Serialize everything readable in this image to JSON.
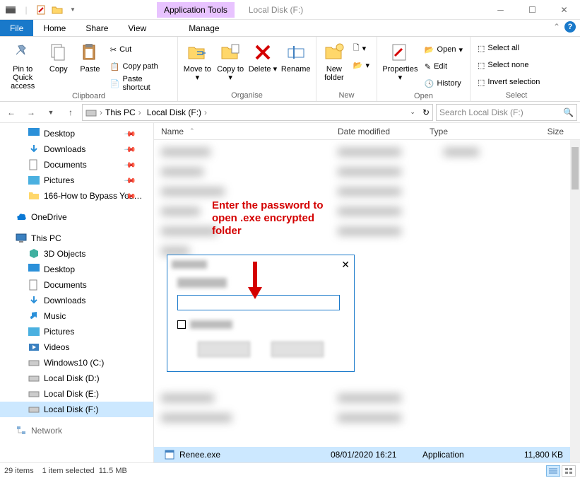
{
  "window": {
    "tools_tab": "Application Tools",
    "title": "Local Disk (F:)"
  },
  "menu": {
    "file": "File",
    "home": "Home",
    "share": "Share",
    "view": "View",
    "manage": "Manage"
  },
  "ribbon": {
    "clipboard": {
      "pin": "Pin to Quick access",
      "copy": "Copy",
      "paste": "Paste",
      "cut": "Cut",
      "copy_path": "Copy path",
      "paste_shortcut": "Paste shortcut",
      "group": "Clipboard"
    },
    "organise": {
      "move_to": "Move to",
      "copy_to": "Copy to",
      "delete": "Delete",
      "rename": "Rename",
      "group": "Organise"
    },
    "new": {
      "new_folder": "New folder",
      "group": "New"
    },
    "open": {
      "properties": "Properties",
      "open": "Open",
      "edit": "Edit",
      "history": "History",
      "group": "Open"
    },
    "select": {
      "select_all": "Select all",
      "select_none": "Select none",
      "invert": "Invert selection",
      "group": "Select"
    }
  },
  "address": {
    "this_pc": "This PC",
    "location": "Local Disk (F:)"
  },
  "search": {
    "placeholder": "Search Local Disk (F:)"
  },
  "columns": {
    "name": "Name",
    "date": "Date modified",
    "type": "Type",
    "size": "Size"
  },
  "nav": {
    "desktop": "Desktop",
    "downloads": "Downloads",
    "documents": "Documents",
    "pictures": "Pictures",
    "bypass": "166-How to Bypass You…",
    "onedrive": "OneDrive",
    "this_pc": "This PC",
    "objects3d": "3D Objects",
    "desktop2": "Desktop",
    "documents2": "Documents",
    "downloads2": "Downloads",
    "music": "Music",
    "pictures2": "Pictures",
    "videos": "Videos",
    "win10": "Windows10 (C:)",
    "diskd": "Local Disk (D:)",
    "diske": "Local Disk (E:)",
    "diskf": "Local Disk (F:)",
    "network": "Network"
  },
  "file_row": {
    "name": "Renee.exe",
    "date": "08/01/2020 16:21",
    "type": "Application",
    "size": "11,800 KB"
  },
  "status": {
    "items": "29 items",
    "selected": "1 item selected",
    "size": "11.5 MB"
  },
  "annotation": {
    "l1": "Enter the password to",
    "l2": "open .exe encrypted",
    "l3": "folder"
  }
}
